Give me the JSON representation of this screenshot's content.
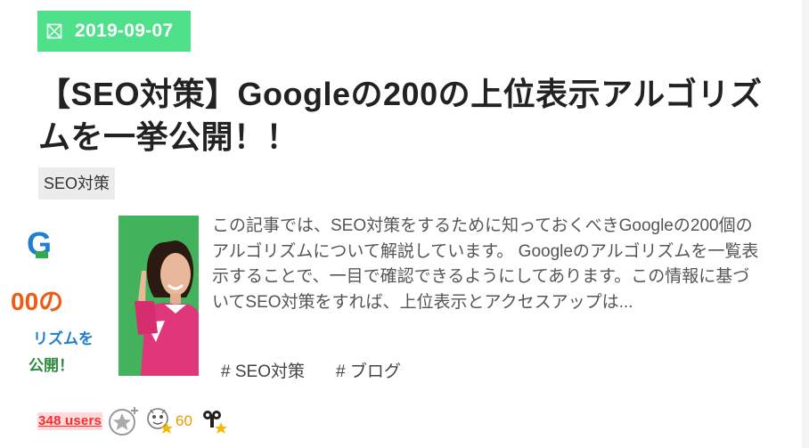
{
  "post": {
    "date": "2019-09-07",
    "title": "【SEO対策】Googleの200の上位表示アルゴリズムを一挙公開！！",
    "category": "SEO対策",
    "excerpt": "この記事では、SEO対策をするために知っておくべきGoogleの200個のアルゴリズムについて解説しています。 Googleのアルゴリズムを一覧表示することで、一目で確認できるようにしてあります。この情報に基づいてSEO対策をすれば、上位表示とアクセスアップは...",
    "tags": [
      "# SEO対策",
      "# ブログ"
    ],
    "thumbnail_text": {
      "line1": "G",
      "line2": "00の",
      "line3": "リズムを",
      "line4": "公開！"
    }
  },
  "social": {
    "hatena_users": "348 users",
    "feedly_count": "60",
    "icons": [
      "add-star-icon",
      "feedly-icon",
      "pocket-icon"
    ]
  },
  "colors": {
    "date_badge": "#4ee08a",
    "users_text": "#ff2a2a",
    "count_text": "#ee9a00",
    "photo_bg": "#43b25c",
    "thumb_orange": "#f05a12",
    "thumb_blue": "#1e7fd1"
  }
}
